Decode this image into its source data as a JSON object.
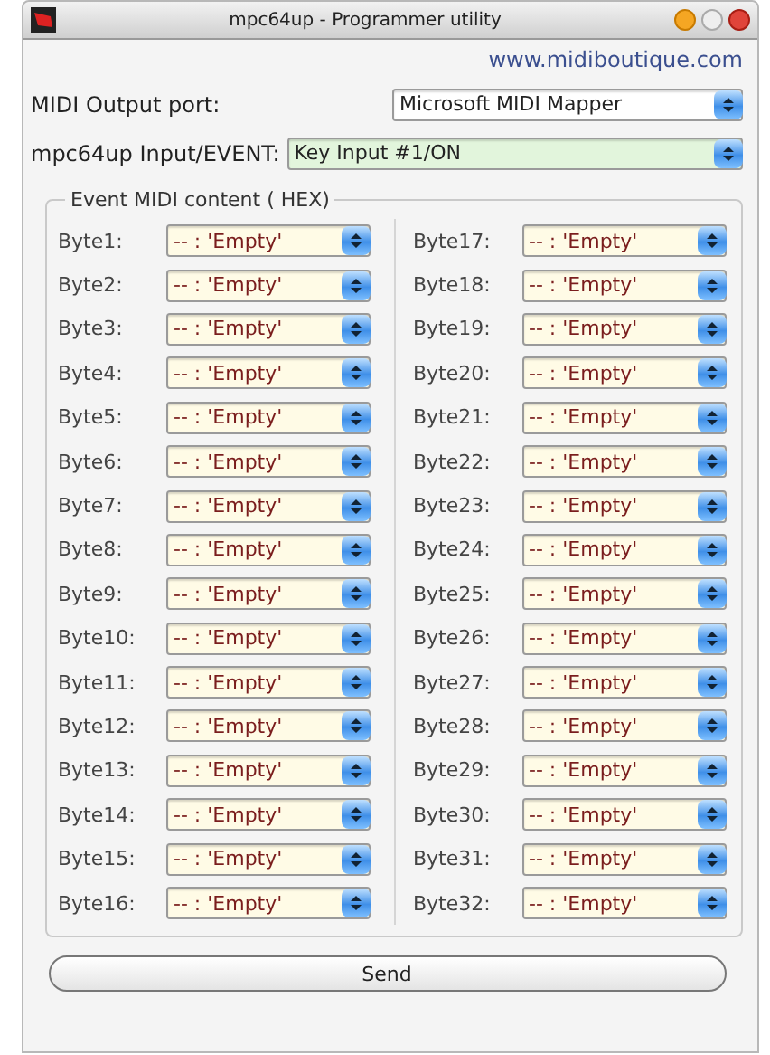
{
  "window": {
    "title": "mpc64up - Programmer utility"
  },
  "link": "www.midiboutique.com",
  "output_port": {
    "label": "MIDI Output port:",
    "value": "Microsoft MIDI Mapper"
  },
  "input_event": {
    "label": "mpc64up Input/EVENT:",
    "value": "Key Input #1/ON"
  },
  "event_group": {
    "legend": "Event MIDI content ( HEX)",
    "bytes": [
      {
        "label": "Byte1:",
        "value": "-- : 'Empty'"
      },
      {
        "label": "Byte2:",
        "value": "-- : 'Empty'"
      },
      {
        "label": "Byte3:",
        "value": "-- : 'Empty'"
      },
      {
        "label": "Byte4:",
        "value": "-- : 'Empty'"
      },
      {
        "label": "Byte5:",
        "value": "-- : 'Empty'"
      },
      {
        "label": "Byte6:",
        "value": "-- : 'Empty'"
      },
      {
        "label": "Byte7:",
        "value": "-- : 'Empty'"
      },
      {
        "label": "Byte8:",
        "value": "-- : 'Empty'"
      },
      {
        "label": "Byte9:",
        "value": "-- : 'Empty'"
      },
      {
        "label": "Byte10:",
        "value": "-- : 'Empty'"
      },
      {
        "label": "Byte11:",
        "value": "-- : 'Empty'"
      },
      {
        "label": "Byte12:",
        "value": "-- : 'Empty'"
      },
      {
        "label": "Byte13:",
        "value": "-- : 'Empty'"
      },
      {
        "label": "Byte14:",
        "value": "-- : 'Empty'"
      },
      {
        "label": "Byte15:",
        "value": "-- : 'Empty'"
      },
      {
        "label": "Byte16:",
        "value": "-- : 'Empty'"
      },
      {
        "label": "Byte17:",
        "value": "-- : 'Empty'"
      },
      {
        "label": "Byte18:",
        "value": "-- : 'Empty'"
      },
      {
        "label": "Byte19:",
        "value": "-- : 'Empty'"
      },
      {
        "label": "Byte20:",
        "value": "-- : 'Empty'"
      },
      {
        "label": "Byte21:",
        "value": "-- : 'Empty'"
      },
      {
        "label": "Byte22:",
        "value": "-- : 'Empty'"
      },
      {
        "label": "Byte23:",
        "value": "-- : 'Empty'"
      },
      {
        "label": "Byte24:",
        "value": "-- : 'Empty'"
      },
      {
        "label": "Byte25:",
        "value": "-- : 'Empty'"
      },
      {
        "label": "Byte26:",
        "value": "-- : 'Empty'"
      },
      {
        "label": "Byte27:",
        "value": "-- : 'Empty'"
      },
      {
        "label": "Byte28:",
        "value": "-- : 'Empty'"
      },
      {
        "label": "Byte29:",
        "value": "-- : 'Empty'"
      },
      {
        "label": "Byte30:",
        "value": "-- : 'Empty'"
      },
      {
        "label": "Byte31:",
        "value": "-- : 'Empty'"
      },
      {
        "label": "Byte32:",
        "value": "-- : 'Empty'"
      }
    ]
  },
  "send_button": "Send"
}
